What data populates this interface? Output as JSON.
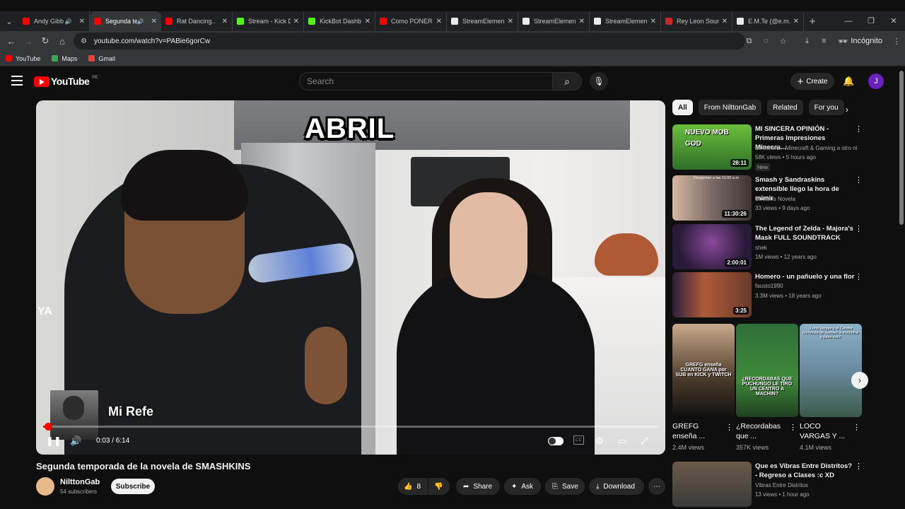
{
  "browser": {
    "tabs": [
      {
        "title": "Andy Gibb",
        "color": "#ff0000",
        "audio": true
      },
      {
        "title": "Segunda te",
        "color": "#ff0000",
        "audio": true,
        "active": true
      },
      {
        "title": "Rat Dancing..",
        "color": "#ff0000"
      },
      {
        "title": "Stream - Kick D",
        "color": "#53fc18"
      },
      {
        "title": "KickBot Dashb",
        "color": "#53fc18"
      },
      {
        "title": "Como PONER",
        "color": "#ff0000"
      },
      {
        "title": "StreamElement",
        "color": "#e8eaed"
      },
      {
        "title": "StreamElemen",
        "color": "#e8eaed"
      },
      {
        "title": "StreamElemen",
        "color": "#e8eaed"
      },
      {
        "title": "Rey Leon Soun",
        "color": "#c62828"
      },
      {
        "title": "E.M.Te (@e.m.t",
        "color": "#e8eaed"
      }
    ],
    "url": "youtube.com/watch?v=PABie6gorCw",
    "incognito_label": "Incógnito",
    "bookmarks": [
      {
        "label": "YouTube",
        "color": "#ff0000"
      },
      {
        "label": "Maps",
        "color": "#34a853"
      },
      {
        "label": "Gmail",
        "color": "#ea4335"
      }
    ]
  },
  "yt": {
    "logo_text": "YouTube",
    "region": "PE",
    "search_placeholder": "Search",
    "create_label": "Create",
    "avatar_letter": "J"
  },
  "player": {
    "overlay_title": "ABRIL",
    "overlay_left": "YA",
    "overlay_sub": "Mi Refe",
    "time": "0:03 / 6:14",
    "progress": 0.008
  },
  "video": {
    "title": "Segunda temporada de la novela de SMASHKINS",
    "channel": "NilttonGab",
    "subscribers": "54 subscribers",
    "subscribe_label": "Subscribe",
    "likes": "8",
    "share": "Share",
    "ask": "Ask",
    "save": "Save",
    "download": "Download"
  },
  "sidebar": {
    "chips": [
      "All",
      "From NilttonGab",
      "Related",
      "For you"
    ],
    "recs": [
      {
        "title": "MI SINCERA OPINIÓN - Primeras Impresiones Minecra...",
        "channel": "ElRichMC - Minecraft & Gaming a otro ni...",
        "meta": "58K views • 5 hours ago",
        "badge": "New",
        "duration": "28:11",
        "thumb_text": "NUEVO MOB GOD"
      },
      {
        "title": "Smash y Sandraskins extensible llego la hora de mimir",
        "channel": "Streams Novela",
        "meta": "33 views • 9 days ago",
        "duration": "11:30:26",
        "thumb_text": "Despertan a las 11:00 a.m"
      },
      {
        "title": "The Legend of Zelda - Majora's Mask FULL SOUNDTRACK",
        "channel": "shek",
        "meta": "1M views • 12 years ago",
        "duration": "2:00:01"
      },
      {
        "title": "Homero - un pañuelo y una flor",
        "channel": "fausto1990",
        "meta": "3.3M views • 18 years ago",
        "duration": "3:25"
      }
    ],
    "shorts": [
      {
        "title": "GREFG enseña ...",
        "views": "2.4M views",
        "thumb_text": "GREFG enseña CUANTO GANA por SUB en KICK y TWITCH"
      },
      {
        "title": "¿Recordabas que ...",
        "views": "357K views",
        "thumb_text": "¿RECORDABAS QUE PUCHUNGO LE TIRO UN CENTRO A MACHIN?"
      },
      {
        "title": "LOCO VARGAS Y ...",
        "views": "4.1M views",
        "thumb_text": "¡Loco Vargas y el Condor Mendoza se vuelven a encontrar y pasa esto!"
      }
    ],
    "rec5": {
      "title": "Que es Vibras Entre Distritos? - Regreso a Clases :c XD",
      "channel": "Vibras Entre Distritos",
      "meta": "13 views • 1 hour ago"
    }
  }
}
